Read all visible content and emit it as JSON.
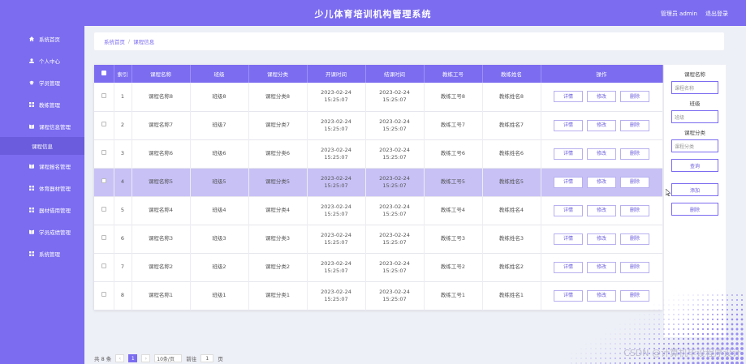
{
  "header": {
    "title": "少儿体育培训机构管理系统",
    "user": "管理员 admin",
    "logout": "退出登录"
  },
  "sidebar": {
    "items": [
      {
        "label": "系统首页",
        "icon": "home-icon"
      },
      {
        "label": "个人中心",
        "icon": "user-icon"
      },
      {
        "label": "学员管理",
        "icon": "student-icon"
      },
      {
        "label": "教练管理",
        "icon": "grid-icon"
      },
      {
        "label": "课程信息管理",
        "icon": "book-icon"
      },
      {
        "label": "课程报名管理",
        "icon": "book-icon"
      },
      {
        "label": "体育器材管理",
        "icon": "grid-icon"
      },
      {
        "label": "器材借用管理",
        "icon": "grid-icon"
      },
      {
        "label": "学员成绩管理",
        "icon": "book-icon"
      },
      {
        "label": "系统管理",
        "icon": "grid-icon"
      }
    ],
    "sub_active": "课程信息"
  },
  "breadcrumb": {
    "home": "系统首页",
    "current": "课程信息"
  },
  "table": {
    "headers": [
      "索引",
      "课程名称",
      "班级",
      "课程分类",
      "开课时间",
      "结课时间",
      "教练工号",
      "教练姓名",
      "操作"
    ],
    "rows": [
      {
        "idx": "1",
        "name": "课程名称8",
        "cls": "班级8",
        "cat": "课程分类8",
        "start": "2023-02-24 15:25:07",
        "end": "2023-02-24 15:25:07",
        "no": "教练工号8",
        "coach": "教练姓名8"
      },
      {
        "idx": "2",
        "name": "课程名称7",
        "cls": "班级7",
        "cat": "课程分类7",
        "start": "2023-02-24 15:25:07",
        "end": "2023-02-24 15:25:07",
        "no": "教练工号7",
        "coach": "教练姓名7"
      },
      {
        "idx": "3",
        "name": "课程名称6",
        "cls": "班级6",
        "cat": "课程分类6",
        "start": "2023-02-24 15:25:07",
        "end": "2023-02-24 15:25:07",
        "no": "教练工号6",
        "coach": "教练姓名6"
      },
      {
        "idx": "4",
        "name": "课程名称5",
        "cls": "班级5",
        "cat": "课程分类5",
        "start": "2023-02-24 15:25:07",
        "end": "2023-02-24 15:25:07",
        "no": "教练工号5",
        "coach": "教练姓名5"
      },
      {
        "idx": "5",
        "name": "课程名称4",
        "cls": "班级4",
        "cat": "课程分类4",
        "start": "2023-02-24 15:25:07",
        "end": "2023-02-24 15:25:07",
        "no": "教练工号4",
        "coach": "教练姓名4"
      },
      {
        "idx": "6",
        "name": "课程名称3",
        "cls": "班级3",
        "cat": "课程分类3",
        "start": "2023-02-24 15:25:07",
        "end": "2023-02-24 15:25:07",
        "no": "教练工号3",
        "coach": "教练姓名3"
      },
      {
        "idx": "7",
        "name": "课程名称2",
        "cls": "班级2",
        "cat": "课程分类2",
        "start": "2023-02-24 15:25:07",
        "end": "2023-02-24 15:25:07",
        "no": "教练工号2",
        "coach": "教练姓名2"
      },
      {
        "idx": "8",
        "name": "课程名称1",
        "cls": "班级1",
        "cat": "课程分类1",
        "start": "2023-02-24 15:25:07",
        "end": "2023-02-24 15:25:07",
        "no": "教练工号1",
        "coach": "教练姓名1"
      }
    ],
    "actions": {
      "detail": "详情",
      "edit": "修改",
      "delete": "删除"
    },
    "highlight_row": 4
  },
  "search": {
    "course_label": "课程名称",
    "course_placeholder": "课程名称",
    "class_label": "班级",
    "class_placeholder": "班级",
    "category_label": "课程分类",
    "category_placeholder": "课程分类",
    "query": "查询",
    "add": "添加",
    "delete": "删除"
  },
  "pager": {
    "total": "共 8 条",
    "page": "1",
    "size": "10条/页",
    "goto": "前往",
    "goto_value": "1",
    "unit": "页"
  },
  "watermark": "CSDN @计算机毕设程序设计",
  "colors": {
    "accent": "#7b6cf0",
    "highlight": "#c7c1f6"
  }
}
